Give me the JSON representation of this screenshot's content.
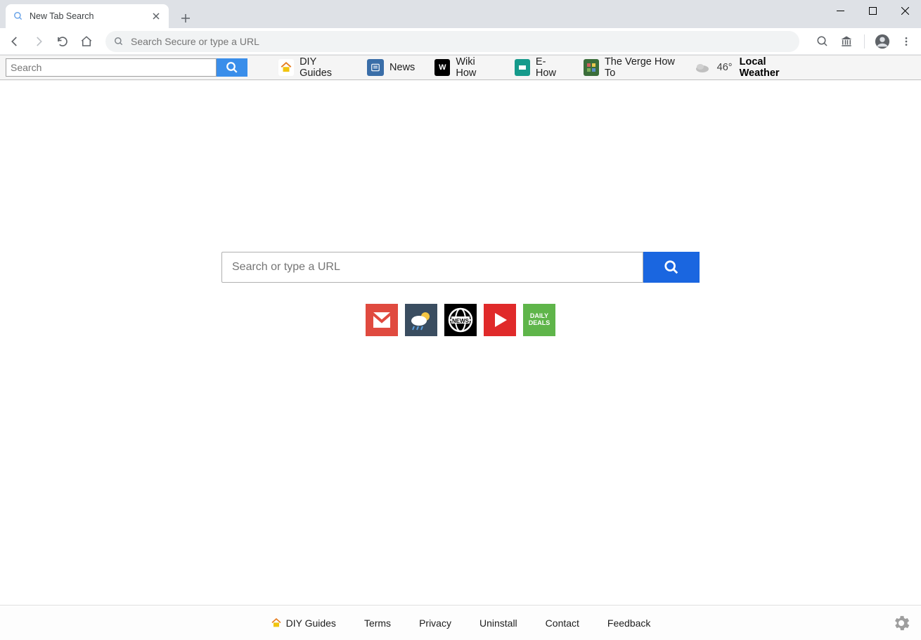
{
  "window": {
    "controls": {
      "minimize": "minimize",
      "maximize": "maximize",
      "close": "close"
    }
  },
  "tab": {
    "title": "New Tab Search"
  },
  "omnibox": {
    "placeholder": "Search Secure or type a URL"
  },
  "ext": {
    "search_placeholder": "Search",
    "links": [
      {
        "label": "DIY Guides"
      },
      {
        "label": "News"
      },
      {
        "label": "Wiki How"
      },
      {
        "label": "E-How"
      },
      {
        "label": "The Verge How To"
      }
    ],
    "weather": {
      "temp": "46°",
      "label": "Local Weather"
    }
  },
  "center": {
    "placeholder": "Search or type a URL"
  },
  "tiles": {
    "deals_line1": "DAILY",
    "deals_line2": "DEALS"
  },
  "footer": {
    "links": [
      {
        "label": "DIY Guides"
      },
      {
        "label": "Terms"
      },
      {
        "label": "Privacy"
      },
      {
        "label": "Uninstall"
      },
      {
        "label": "Contact"
      },
      {
        "label": "Feedback"
      }
    ]
  }
}
